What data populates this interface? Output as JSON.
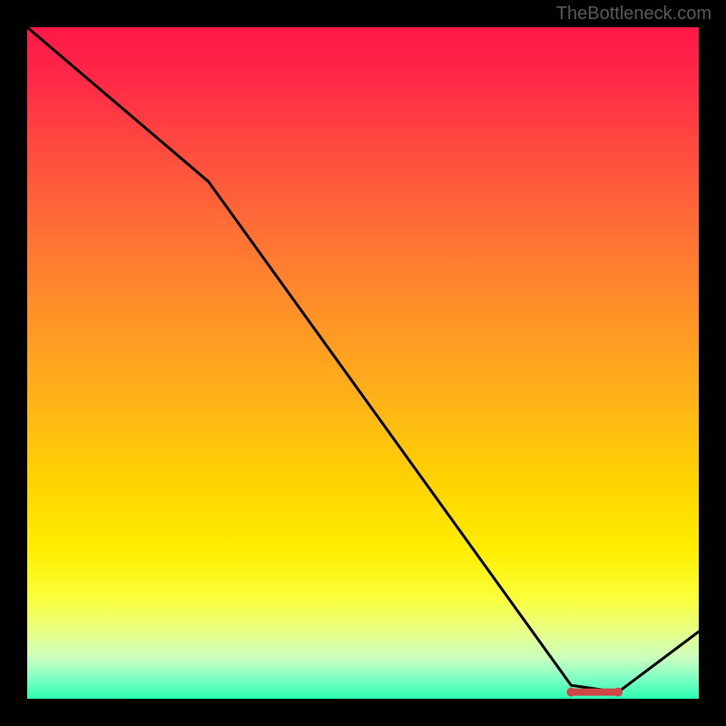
{
  "watermark": "TheBottleneck.com",
  "chart_data": {
    "type": "line",
    "title": "",
    "xlabel": "",
    "ylabel": "",
    "xlim": [
      0,
      100
    ],
    "ylim": [
      0,
      100
    ],
    "grid": false,
    "legend": false,
    "background": {
      "kind": "vertical-gradient",
      "stops": [
        {
          "pos": 0.0,
          "color": "#ff1748"
        },
        {
          "pos": 0.3,
          "color": "#ff6e36"
        },
        {
          "pos": 0.68,
          "color": "#ffd400"
        },
        {
          "pos": 0.9,
          "color": "#e9ff87"
        },
        {
          "pos": 1.0,
          "color": "#2bffb1"
        }
      ]
    },
    "series": [
      {
        "name": "bottleneck-curve",
        "color": "#000000",
        "x": [
          0,
          27,
          81,
          88,
          100
        ],
        "values": [
          100,
          77,
          2,
          1,
          10
        ]
      }
    ],
    "markers": {
      "color": "#d04545",
      "shape": "rounded-bar",
      "x_range": [
        81,
        88
      ],
      "y": 1
    }
  }
}
